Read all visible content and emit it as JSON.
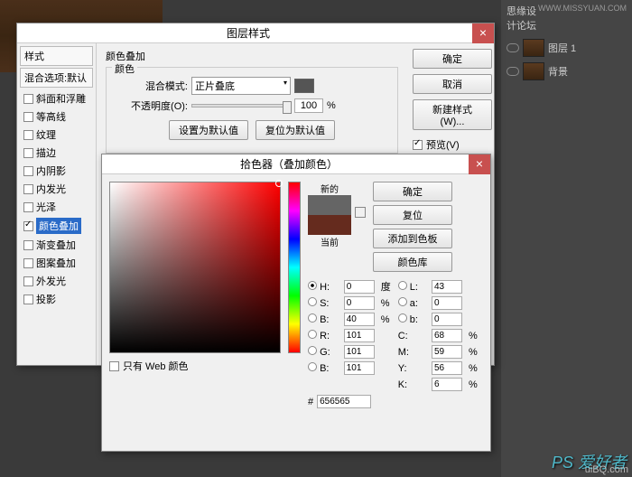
{
  "layers": {
    "panel_title": "思缘设计论坛",
    "url": "WWW.MISSYUAN.COM",
    "layer1": "图层 1",
    "bg": "背景"
  },
  "ls": {
    "title": "图层样式",
    "side": {
      "styles": "样式",
      "blend": "混合选项:默认",
      "bevel": "斜面和浮雕",
      "contour": "等高线",
      "texture": "纹理",
      "stroke": "描边",
      "inshadow": "内阴影",
      "inglow": "内发光",
      "satin": "光泽",
      "coloroverlay": "颜色叠加",
      "gradoverlay": "渐变叠加",
      "patoverlay": "图案叠加",
      "outglow": "外发光",
      "drop": "投影"
    },
    "grp_title": "颜色叠加",
    "color_lbl": "颜色",
    "mode_lbl": "混合模式:",
    "mode_val": "正片叠底",
    "op_lbl": "不透明度(O):",
    "op_val": "100",
    "op_unit": "%",
    "setdef": "设置为默认值",
    "resetdef": "复位为默认值",
    "ok": "确定",
    "cancel": "取消",
    "newstyle": "新建样式(W)...",
    "preview": "预览(V)"
  },
  "cp": {
    "title": "拾色器（叠加颜色）",
    "new": "新的",
    "cur": "当前",
    "ok": "确定",
    "reset": "复位",
    "swatch": "添加到色板",
    "lib": "颜色库",
    "H": "H:",
    "Hv": "0",
    "Hu": "度",
    "S": "S:",
    "Sv": "0",
    "Su": "%",
    "B": "B:",
    "Bv": "40",
    "Bu": "%",
    "L": "L:",
    "Lv": "43",
    "a": "a:",
    "av": "0",
    "b": "b:",
    "bv": "0",
    "R": "R:",
    "Rv": "101",
    "G": "G:",
    "Gv": "101",
    "Bc": "B:",
    "Bcv": "101",
    "C": "C:",
    "Cv": "68",
    "Cu": "%",
    "M": "M:",
    "Mv": "59",
    "Y": "Y:",
    "Yv": "56",
    "K": "K:",
    "Kv": "6",
    "web": "只有 Web 颜色",
    "hex": "656565",
    "hash": "#"
  },
  "wm": "PS 爱好者",
  "ub": "uiBQ.com"
}
